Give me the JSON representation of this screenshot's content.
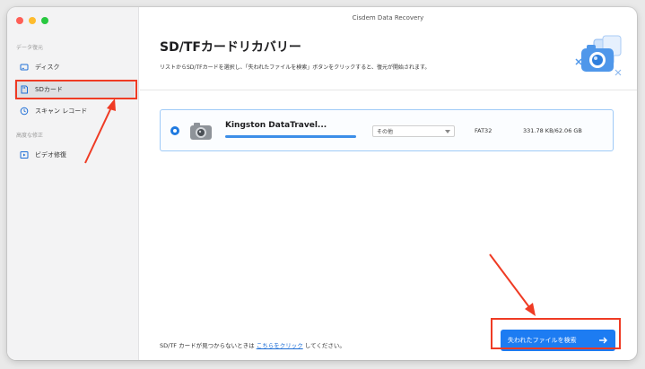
{
  "window": {
    "title": "Cisdem Data Recovery"
  },
  "sidebar": {
    "section1_label": "データ復元",
    "items": [
      {
        "label": "ディスク",
        "icon": "disk-icon"
      },
      {
        "label": "SDカード",
        "icon": "sd-card-icon"
      },
      {
        "label": "スキャン レコード",
        "icon": "history-icon"
      }
    ],
    "section2_label": "高度な修正",
    "items2": [
      {
        "label": "ビデオ修復",
        "icon": "video-icon"
      }
    ]
  },
  "main": {
    "title": "SD/TFカードリカバリー",
    "subtitle": "リストからSD/TFカードを選択し、「失われたファイルを検索」ボタンをクリックすると、復元が開始されます。",
    "device": {
      "name": "Kingston DataTravel...",
      "progress": 1.0,
      "type_select": "その他",
      "filesystem": "FAT32",
      "size": "331.78 KB/62.06 GB"
    },
    "footer": {
      "note_prefix": "SD/TF カードが見つからないときは",
      "link": "こちらをクリック",
      "note_suffix": "してください。"
    },
    "scan_button": "失われたファイルを検索"
  },
  "colors": {
    "accent": "#1d7cf2",
    "annotation": "#ef3b24"
  }
}
